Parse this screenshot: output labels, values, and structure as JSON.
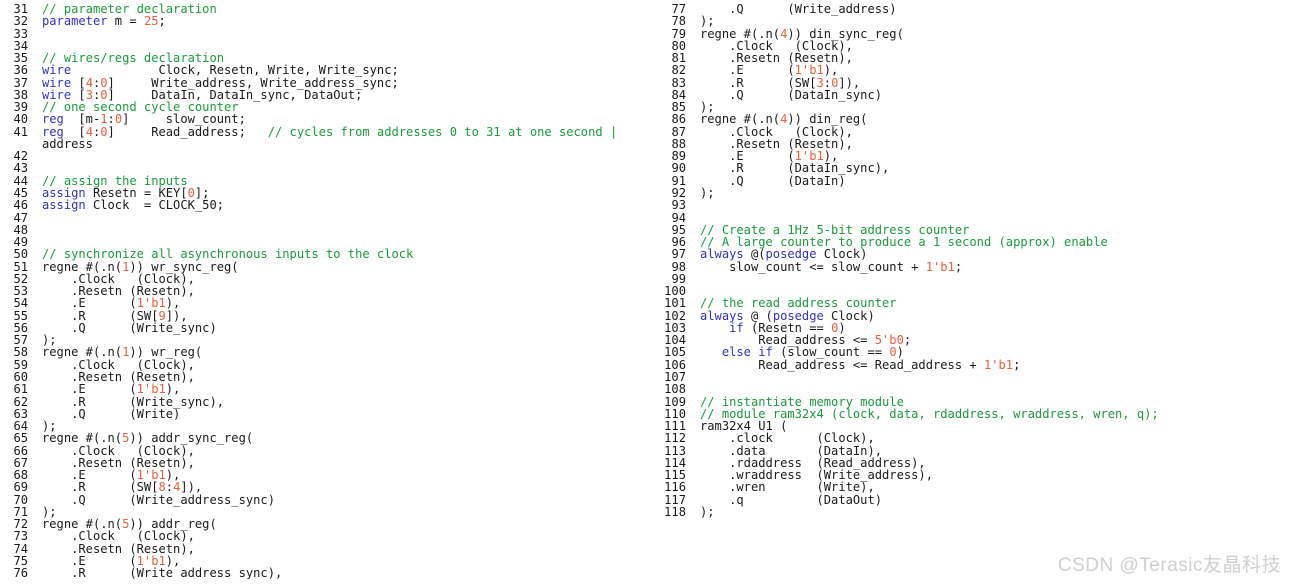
{
  "editor": {
    "language": "verilog",
    "colors": {
      "background": "#ffffff",
      "text": "#1b1b1b",
      "keyword": "#3333bb",
      "number": "#e8603c",
      "comment": "#1a9b3c",
      "line_number": "#1b1b1b",
      "watermark": "#d0d0d0"
    }
  },
  "watermark": {
    "text": "CSDN @Terasic友晶科技"
  },
  "columns": [
    {
      "name": "left-column",
      "first_line": 31,
      "last_line": 76,
      "line_numbers": [
        "31",
        "32",
        "33",
        "34",
        "35",
        "36",
        "37",
        "38",
        "39",
        "40",
        "41",
        "",
        "42",
        "43",
        "44",
        "45",
        "46",
        "47",
        "48",
        "49",
        "50",
        "51",
        "52",
        "53",
        "54",
        "55",
        "56",
        "57",
        "58",
        "59",
        "60",
        "61",
        "62",
        "63",
        "64",
        "65",
        "66",
        "67",
        "68",
        "69",
        "70",
        "71",
        "72",
        "73",
        "74",
        "75",
        "76"
      ],
      "lines": [
        [
          {
            "t": "// parameter declaration",
            "c": "cm"
          }
        ],
        [
          {
            "t": "parameter",
            "c": "kw"
          },
          {
            "t": " m = ",
            "c": "pl"
          },
          {
            "t": "25",
            "c": "num"
          },
          {
            "t": ";",
            "c": "pl"
          }
        ],
        [],
        [],
        [
          {
            "t": "// wires/regs declaration",
            "c": "cm"
          }
        ],
        [
          {
            "t": "wire",
            "c": "kw"
          },
          {
            "t": "            Clock, Resetn, Write, Write_sync;",
            "c": "pl"
          }
        ],
        [
          {
            "t": "wire",
            "c": "kw"
          },
          {
            "t": " [",
            "c": "pl"
          },
          {
            "t": "4",
            "c": "num"
          },
          {
            "t": ":",
            "c": "pl"
          },
          {
            "t": "0",
            "c": "num"
          },
          {
            "t": "]     Write_address, Write_address_sync;",
            "c": "pl"
          }
        ],
        [
          {
            "t": "wire",
            "c": "kw"
          },
          {
            "t": " [",
            "c": "pl"
          },
          {
            "t": "3",
            "c": "num"
          },
          {
            "t": ":",
            "c": "pl"
          },
          {
            "t": "0",
            "c": "num"
          },
          {
            "t": "]     DataIn, DataIn_sync, DataOut;",
            "c": "pl"
          }
        ],
        [
          {
            "t": "// one second cycle counter",
            "c": "cm"
          }
        ],
        [
          {
            "t": "reg",
            "c": "kw"
          },
          {
            "t": "  [m-",
            "c": "pl"
          },
          {
            "t": "1",
            "c": "num"
          },
          {
            "t": ":",
            "c": "pl"
          },
          {
            "t": "0",
            "c": "num"
          },
          {
            "t": "]     slow_count;",
            "c": "pl"
          }
        ],
        [
          {
            "t": "reg",
            "c": "kw"
          },
          {
            "t": "  [",
            "c": "pl"
          },
          {
            "t": "4",
            "c": "num"
          },
          {
            "t": ":",
            "c": "pl"
          },
          {
            "t": "0",
            "c": "num"
          },
          {
            "t": "]     Read_address;   ",
            "c": "pl"
          },
          {
            "t": "// cycles from addresses 0 to 31 at one second ",
            "c": "cm"
          },
          {
            "t": "|",
            "c": "cursorbar"
          }
        ],
        [
          {
            "t": "address",
            "c": "pl"
          }
        ],
        [],
        [],
        [
          {
            "t": "// assign the inputs",
            "c": "cm"
          }
        ],
        [
          {
            "t": "assign",
            "c": "kw"
          },
          {
            "t": " Resetn = KEY[",
            "c": "pl"
          },
          {
            "t": "0",
            "c": "num"
          },
          {
            "t": "];",
            "c": "pl"
          }
        ],
        [
          {
            "t": "assign",
            "c": "kw"
          },
          {
            "t": " Clock  = CLOCK_50;",
            "c": "pl"
          }
        ],
        [],
        [],
        [],
        [
          {
            "t": "// synchronize all asynchronous inputs to the clock",
            "c": "cm"
          }
        ],
        [
          {
            "t": "regne #(.n(",
            "c": "pl"
          },
          {
            "t": "1",
            "c": "num"
          },
          {
            "t": ")) wr_sync_reg(",
            "c": "pl"
          }
        ],
        [
          {
            "t": "    .Clock   (Clock),",
            "c": "pl"
          }
        ],
        [
          {
            "t": "    .Resetn (Resetn),",
            "c": "pl"
          }
        ],
        [
          {
            "t": "    .E      (",
            "c": "pl"
          },
          {
            "t": "1'b1",
            "c": "num"
          },
          {
            "t": "),",
            "c": "pl"
          }
        ],
        [
          {
            "t": "    .R      (SW[",
            "c": "pl"
          },
          {
            "t": "9",
            "c": "num"
          },
          {
            "t": "]),",
            "c": "pl"
          }
        ],
        [
          {
            "t": "    .Q      (Write_sync)",
            "c": "pl"
          }
        ],
        [
          {
            "t": ");",
            "c": "pl"
          }
        ],
        [
          {
            "t": "regne #(.n(",
            "c": "pl"
          },
          {
            "t": "1",
            "c": "num"
          },
          {
            "t": ")) wr_reg(",
            "c": "pl"
          }
        ],
        [
          {
            "t": "    .Clock   (Clock),",
            "c": "pl"
          }
        ],
        [
          {
            "t": "    .Resetn (Resetn),",
            "c": "pl"
          }
        ],
        [
          {
            "t": "    .E      (",
            "c": "pl"
          },
          {
            "t": "1'b1",
            "c": "num"
          },
          {
            "t": "),",
            "c": "pl"
          }
        ],
        [
          {
            "t": "    .R      (Write_sync),",
            "c": "pl"
          }
        ],
        [
          {
            "t": "    .Q      (Write)",
            "c": "pl"
          }
        ],
        [
          {
            "t": ");",
            "c": "pl"
          }
        ],
        [
          {
            "t": "regne #(.n(",
            "c": "pl"
          },
          {
            "t": "5",
            "c": "num"
          },
          {
            "t": ")) addr_sync_reg(",
            "c": "pl"
          }
        ],
        [
          {
            "t": "    .Clock   (Clock),",
            "c": "pl"
          }
        ],
        [
          {
            "t": "    .Resetn (Resetn),",
            "c": "pl"
          }
        ],
        [
          {
            "t": "    .E      (",
            "c": "pl"
          },
          {
            "t": "1'b1",
            "c": "num"
          },
          {
            "t": "),",
            "c": "pl"
          }
        ],
        [
          {
            "t": "    .R      (SW[",
            "c": "pl"
          },
          {
            "t": "8",
            "c": "num"
          },
          {
            "t": ":",
            "c": "pl"
          },
          {
            "t": "4",
            "c": "num"
          },
          {
            "t": "]),",
            "c": "pl"
          }
        ],
        [
          {
            "t": "    .Q      (Write_address_sync)",
            "c": "pl"
          }
        ],
        [
          {
            "t": ");",
            "c": "pl"
          }
        ],
        [
          {
            "t": "regne #(.n(",
            "c": "pl"
          },
          {
            "t": "5",
            "c": "num"
          },
          {
            "t": ")) addr_reg(",
            "c": "pl"
          }
        ],
        [
          {
            "t": "    .Clock   (Clock),",
            "c": "pl"
          }
        ],
        [
          {
            "t": "    .Resetn (Resetn),",
            "c": "pl"
          }
        ],
        [
          {
            "t": "    .E      (",
            "c": "pl"
          },
          {
            "t": "1'b1",
            "c": "num"
          },
          {
            "t": "),",
            "c": "pl"
          }
        ],
        [
          {
            "t": "    .R      (Write_address_sync),",
            "c": "pl"
          }
        ]
      ]
    },
    {
      "name": "right-column",
      "first_line": 77,
      "last_line": 118,
      "line_numbers": [
        "77",
        "78",
        "79",
        "80",
        "81",
        "82",
        "83",
        "84",
        "85",
        "86",
        "87",
        "88",
        "89",
        "90",
        "91",
        "92",
        "93",
        "94",
        "95",
        "96",
        "97",
        "98",
        "99",
        "100",
        "101",
        "102",
        "103",
        "104",
        "105",
        "106",
        "107",
        "108",
        "109",
        "110",
        "111",
        "112",
        "113",
        "114",
        "115",
        "116",
        "117",
        "118"
      ],
      "lines": [
        [
          {
            "t": "    .Q      (Write_address)",
            "c": "pl"
          }
        ],
        [
          {
            "t": ");",
            "c": "pl"
          }
        ],
        [
          {
            "t": "regne #(.n(",
            "c": "pl"
          },
          {
            "t": "4",
            "c": "num"
          },
          {
            "t": ")) din_sync_reg(",
            "c": "pl"
          }
        ],
        [
          {
            "t": "    .Clock   (Clock),",
            "c": "pl"
          }
        ],
        [
          {
            "t": "    .Resetn (Resetn),",
            "c": "pl"
          }
        ],
        [
          {
            "t": "    .E      (",
            "c": "pl"
          },
          {
            "t": "1'b1",
            "c": "num"
          },
          {
            "t": "),",
            "c": "pl"
          }
        ],
        [
          {
            "t": "    .R      (SW[",
            "c": "pl"
          },
          {
            "t": "3",
            "c": "num"
          },
          {
            "t": ":",
            "c": "pl"
          },
          {
            "t": "0",
            "c": "num"
          },
          {
            "t": "]),",
            "c": "pl"
          }
        ],
        [
          {
            "t": "    .Q      (DataIn_sync)",
            "c": "pl"
          }
        ],
        [
          {
            "t": ");",
            "c": "pl"
          }
        ],
        [
          {
            "t": "regne #(.n(",
            "c": "pl"
          },
          {
            "t": "4",
            "c": "num"
          },
          {
            "t": ")) din_reg(",
            "c": "pl"
          }
        ],
        [
          {
            "t": "    .Clock   (Clock),",
            "c": "pl"
          }
        ],
        [
          {
            "t": "    .Resetn (Resetn),",
            "c": "pl"
          }
        ],
        [
          {
            "t": "    .E      (",
            "c": "pl"
          },
          {
            "t": "1'b1",
            "c": "num"
          },
          {
            "t": "),",
            "c": "pl"
          }
        ],
        [
          {
            "t": "    .R      (DataIn_sync),",
            "c": "pl"
          }
        ],
        [
          {
            "t": "    .Q      (DataIn)",
            "c": "pl"
          }
        ],
        [
          {
            "t": ");",
            "c": "pl"
          }
        ],
        [],
        [],
        [
          {
            "t": "// Create a 1Hz 5-bit address counter",
            "c": "cm"
          }
        ],
        [
          {
            "t": "// A large counter to produce a 1 second (approx) enable",
            "c": "cm"
          }
        ],
        [
          {
            "t": "always",
            "c": "kw"
          },
          {
            "t": " @(",
            "c": "pl"
          },
          {
            "t": "posedge",
            "c": "kw"
          },
          {
            "t": " Clock)",
            "c": "pl"
          }
        ],
        [
          {
            "t": "    slow_count <= slow_count + ",
            "c": "pl"
          },
          {
            "t": "1'b1",
            "c": "num"
          },
          {
            "t": ";",
            "c": "pl"
          }
        ],
        [],
        [],
        [
          {
            "t": "// the read address counter",
            "c": "cm"
          }
        ],
        [
          {
            "t": "always",
            "c": "kw"
          },
          {
            "t": " @ (",
            "c": "pl"
          },
          {
            "t": "posedge",
            "c": "kw"
          },
          {
            "t": " Clock)",
            "c": "pl"
          }
        ],
        [
          {
            "t": "    ",
            "c": "pl"
          },
          {
            "t": "if",
            "c": "kw"
          },
          {
            "t": " (Resetn == ",
            "c": "pl"
          },
          {
            "t": "0",
            "c": "num"
          },
          {
            "t": ")",
            "c": "pl"
          }
        ],
        [
          {
            "t": "        Read_address <= ",
            "c": "pl"
          },
          {
            "t": "5'b0",
            "c": "num"
          },
          {
            "t": ";",
            "c": "pl"
          }
        ],
        [
          {
            "t": "   ",
            "c": "pl"
          },
          {
            "t": "else if",
            "c": "kw"
          },
          {
            "t": " (slow_count == ",
            "c": "pl"
          },
          {
            "t": "0",
            "c": "num"
          },
          {
            "t": ")",
            "c": "pl"
          }
        ],
        [
          {
            "t": "        Read_address <= Read_address + ",
            "c": "pl"
          },
          {
            "t": "1'b1",
            "c": "num"
          },
          {
            "t": ";",
            "c": "pl"
          }
        ],
        [],
        [],
        [
          {
            "t": "// instantiate memory module",
            "c": "cm"
          }
        ],
        [
          {
            "t": "// module ram32x4 (clock, data, rdaddress, wraddress, wren, q);",
            "c": "cm"
          }
        ],
        [
          {
            "t": "ram32x4 U1 (",
            "c": "pl"
          }
        ],
        [
          {
            "t": "    .clock      (Clock),",
            "c": "pl"
          }
        ],
        [
          {
            "t": "    .data       (DataIn),",
            "c": "pl"
          }
        ],
        [
          {
            "t": "    .rdaddress  (Read_address),",
            "c": "pl"
          }
        ],
        [
          {
            "t": "    .wraddress  (Write_address),",
            "c": "pl"
          }
        ],
        [
          {
            "t": "    .wren       (Write),",
            "c": "pl"
          }
        ],
        [
          {
            "t": "    .q          (DataOut)",
            "c": "pl"
          }
        ],
        [
          {
            "t": ");",
            "c": "pl"
          }
        ]
      ]
    }
  ]
}
